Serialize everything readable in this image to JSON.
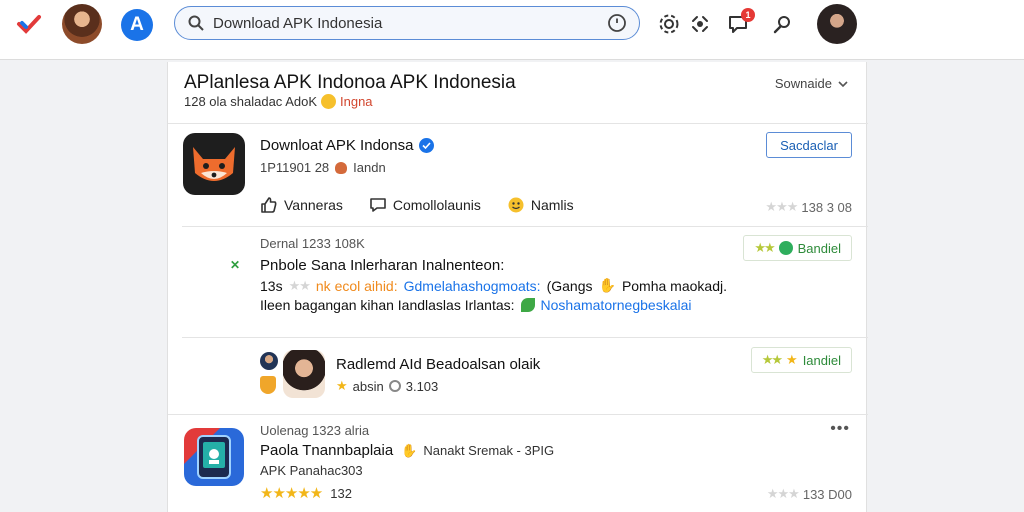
{
  "topbar": {
    "app_initial": "A",
    "search_value": "Download APK Indonesia",
    "notification_count": "1"
  },
  "feed": {
    "title": "APlanlesa APK Indonoa APK Indonesia",
    "subtitle_count": "128 ola shaladac AdoK",
    "subtitle_tag": "Ingna",
    "sort_label": "Sownaide"
  },
  "post1": {
    "app_name": "Downloat APK Indonsa",
    "meta": "1P11901 28",
    "meta_tail": "Iandn",
    "action_button": "Sacdaclar",
    "actions": [
      {
        "label": "Vanneras"
      },
      {
        "label": "Comollolaunis"
      },
      {
        "label": "Namlis"
      }
    ],
    "score": "138 3 08"
  },
  "post2": {
    "head": "Dernal 1233 108K",
    "line1": "Pnbole Sana Inlerharan Inalnenteon:",
    "line2_a": "13s",
    "line2_b": "nk ecol aihid:",
    "line2_c": "Gdmelahashogmoats:",
    "line2_d": "(Gangs",
    "line2_e": "Pomha maokadj.",
    "line3_a": "Ileen bagangan kihan Iandlaslas Irlantas:",
    "line3_b": "Noshamatornegbeskalai",
    "tag": "Bandiel"
  },
  "post3": {
    "reviewer": "Radlemd AId Beadoalsan olaik",
    "meta_a": "absin",
    "meta_b": "3.103",
    "tag": "Iandiel"
  },
  "post4": {
    "head": "Uolenag 1323 alria",
    "app_name": "Paola Tnannbaplaia",
    "sub": "Nanakt Sremak - 3PIG",
    "dev": "APK Panahac303",
    "rating": "132",
    "score": "133 D00"
  },
  "colors": {
    "accent": "#1a73e8",
    "star": "#f2b619",
    "tag_green": "#2e8b3a",
    "alert": "#e53935"
  }
}
